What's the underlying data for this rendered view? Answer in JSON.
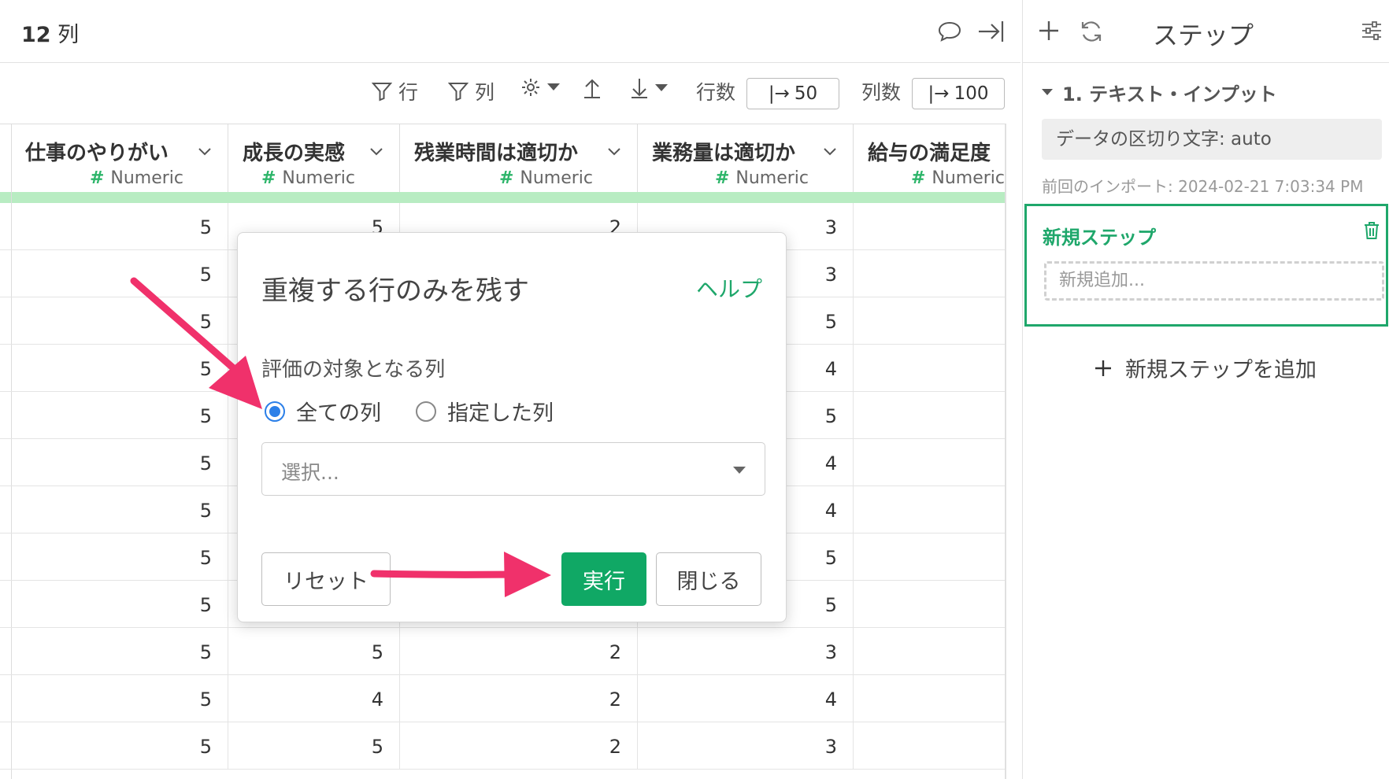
{
  "colors": {
    "accent": "#1fa76b",
    "run_button": "#10a865",
    "radio_selected": "#2b7fe8",
    "arrow": "#f0316b",
    "numeric_bar": "#b8ecc2"
  },
  "header": {
    "column_count_number": "12",
    "column_count_unit": "列"
  },
  "toolbar": {
    "row_filter_label": "行",
    "column_filter_label": "列",
    "row_count_label": "行数",
    "row_count_value": "50",
    "column_count_label": "列数",
    "column_count_value": "100"
  },
  "table": {
    "columns": [
      {
        "name": "仕事のやりがい",
        "type": "Numeric"
      },
      {
        "name": "成長の実感",
        "type": "Numeric"
      },
      {
        "name": "残業時間は適切か",
        "type": "Numeric"
      },
      {
        "name": "業務量は適切か",
        "type": "Numeric"
      },
      {
        "name": "給与の満足度",
        "type": "Numeric"
      }
    ],
    "rows": [
      [
        "5",
        "5",
        "2",
        "3",
        ""
      ],
      [
        "5",
        "",
        "",
        "3",
        ""
      ],
      [
        "5",
        "",
        "",
        "5",
        ""
      ],
      [
        "5",
        "",
        "",
        "4",
        ""
      ],
      [
        "5",
        "",
        "",
        "5",
        ""
      ],
      [
        "5",
        "",
        "",
        "4",
        ""
      ],
      [
        "5",
        "",
        "",
        "4",
        ""
      ],
      [
        "5",
        "",
        "",
        "5",
        ""
      ],
      [
        "5",
        "",
        "",
        "5",
        ""
      ],
      [
        "5",
        "5",
        "2",
        "3",
        ""
      ],
      [
        "5",
        "4",
        "2",
        "4",
        ""
      ],
      [
        "5",
        "5",
        "2",
        "3",
        ""
      ]
    ]
  },
  "side": {
    "title": "ステップ",
    "step1_title": "1. テキスト・インプット",
    "step1_setting": "データの区切り文字: auto",
    "step1_meta": "前回のインポート: 2024-02-21 7:03:34 PM",
    "new_step_title": "新規ステップ",
    "new_step_placeholder": "新規追加...",
    "add_step_label": "新規ステップを追加"
  },
  "modal": {
    "title": "重複する行のみを残す",
    "help": "ヘルプ",
    "label": "評価の対象となる列",
    "radio_all": "全ての列",
    "radio_specified": "指定した列",
    "selected_option": "all",
    "select_placeholder": "選択...",
    "reset": "リセット",
    "run": "実行",
    "close": "閉じる"
  }
}
